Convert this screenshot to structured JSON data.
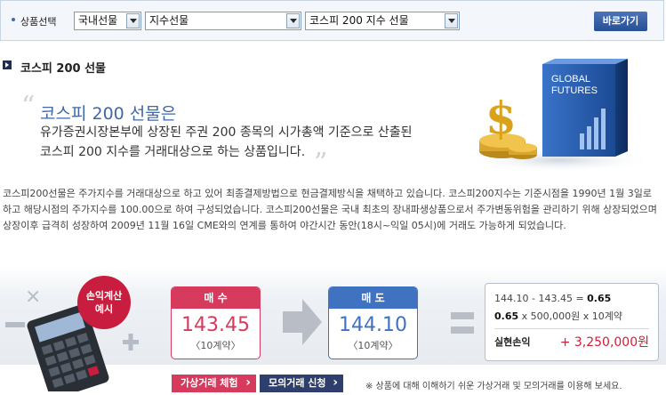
{
  "selector": {
    "label": "상품선택",
    "select1": "국내선물",
    "select2": "지수선물",
    "select3": "코스피 200 지수 선물",
    "go_button": "바로가기"
  },
  "section": {
    "title": "코스피 200 선물"
  },
  "quote": {
    "title": "코스피 200 선물은",
    "line1": "유가증권시장본부에 상장된 주권 200 종목의 시가총액 기준으로 산출된",
    "line2": "코스피 200 지수를 거래대상으로 하는 상품입니다."
  },
  "illustration": {
    "text_line1": "GLOBAL",
    "text_line2": "FUTURES"
  },
  "description": "코스피200선물은 주가지수를 거래대상으로 하고 있어 최종결제방법으로 현금결제방식을 채택하고 있습니다. 코스피200지수는 기준시점을 1990년 1월 3일로 하고 해당시점의 주가지수를 100.00으로 하여 구성되었습니다. 코스피200선물은 국내 최초의 장내파생상품으로서 주가변동위험을 관리하기 위해 상장되었으며 상장이후 급격히 성장하여 2009년 11월 16일 CME와의 연계를 통하여 야간시간 동안(18시~익일 05시)에 거래도 가능하게 되었습니다.",
  "calculator": {
    "badge_line1": "손익계산",
    "badge_line2": "예시",
    "buy": {
      "label": "매 수",
      "price": "143.45",
      "qty": "〈10계약〉"
    },
    "sell": {
      "label": "매 도",
      "price": "144.10",
      "qty": "〈10계약〉"
    },
    "result": {
      "line1_expr": "144.10 - 143.45 = ",
      "line1_val": "0.65",
      "line2_val": "0.65",
      "line2_expr": " x 500,000원 x 10계약",
      "total_label": "실현손익",
      "total_value": "+ 3,250,000원"
    }
  },
  "buttons": {
    "virtual": "가상거래 체험",
    "mock": "모의거래 신청"
  },
  "notice": "※ 상품에 대해 이해하기 쉬운 가상거래 및 모의거래를 이용해 보세요.",
  "colors": {
    "buy": "#d63a5d",
    "sell": "#3f72c1",
    "brand_navy": "#2f3f6d",
    "profit": "#d21c3a"
  }
}
